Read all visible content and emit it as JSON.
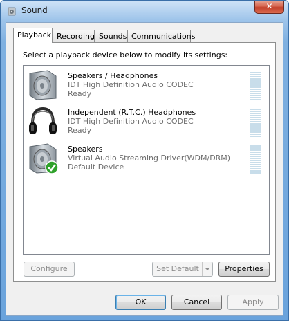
{
  "window": {
    "title": "Sound",
    "close_glyph": "✕"
  },
  "tabs": [
    {
      "label": "Playback",
      "active": true
    },
    {
      "label": "Recording",
      "active": false
    },
    {
      "label": "Sounds",
      "active": false
    },
    {
      "label": "Communications",
      "active": false
    }
  ],
  "playback": {
    "instructions": "Select a playback device below to modify its settings:",
    "devices": [
      {
        "name": "Speakers / Headphones",
        "driver": "IDT High Definition Audio CODEC",
        "status": "Ready",
        "icon": "speaker-icon"
      },
      {
        "name": "Independent (R.T.C.) Headphones",
        "driver": "IDT High Definition Audio CODEC",
        "status": "Ready",
        "icon": "headphones-icon"
      },
      {
        "name": "Speakers",
        "driver": "Virtual Audio Streaming Driver(WDM/DRM)",
        "status": "Default Device",
        "icon": "speaker-default-icon"
      }
    ],
    "configure_label": "Configure",
    "set_default_label": "Set Default",
    "properties_label": "Properties"
  },
  "footer": {
    "ok_label": "OK",
    "cancel_label": "Cancel",
    "apply_label": "Apply"
  },
  "colors": {
    "meter": "#c8ddea",
    "check": "#2fa12b"
  }
}
